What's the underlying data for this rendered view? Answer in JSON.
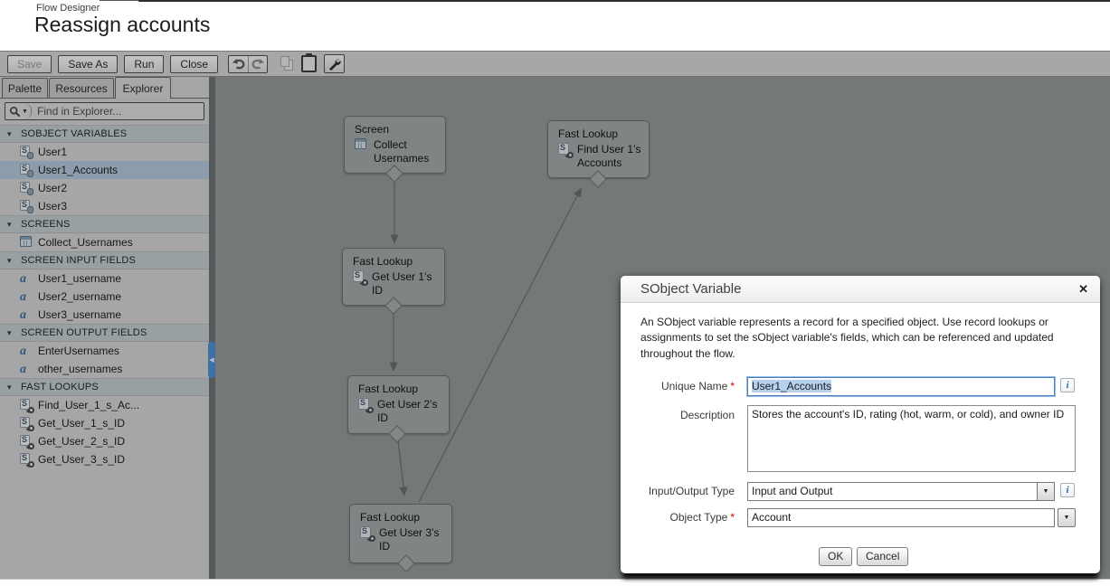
{
  "window": {
    "app_label": "Flow Designer",
    "title": "Reassign accounts"
  },
  "toolbar": {
    "save_label": "Save",
    "save_as_label": "Save As",
    "run_label": "Run",
    "close_label": "Close",
    "icons": [
      "undo-icon",
      "redo-icon",
      "copy-icon",
      "paste-icon",
      "wrench-icon"
    ]
  },
  "sidebar": {
    "tabs": [
      {
        "label": "Palette"
      },
      {
        "label": "Resources"
      },
      {
        "label": "Explorer"
      }
    ],
    "active_tab": "Explorer",
    "search_placeholder": "Find in Explorer...",
    "rows": [
      {
        "kind": "header",
        "label": "SOBJECT VARIABLES"
      },
      {
        "kind": "item",
        "icon": "sobject-variable-icon",
        "label": "User1"
      },
      {
        "kind": "item",
        "icon": "sobject-variable-icon",
        "label": "User1_Accounts",
        "selected": true
      },
      {
        "kind": "item",
        "icon": "sobject-variable-icon",
        "label": "User2"
      },
      {
        "kind": "item",
        "icon": "sobject-variable-icon",
        "label": "User3"
      },
      {
        "kind": "header",
        "label": "SCREENS"
      },
      {
        "kind": "item",
        "icon": "screen-icon",
        "label": "Collect_Usernames"
      },
      {
        "kind": "header",
        "label": "SCREEN INPUT FIELDS"
      },
      {
        "kind": "item",
        "icon": "text-field-icon",
        "label": "User1_username"
      },
      {
        "kind": "item",
        "icon": "text-field-icon",
        "label": "User2_username"
      },
      {
        "kind": "item",
        "icon": "text-field-icon",
        "label": "User3_username"
      },
      {
        "kind": "header",
        "label": "SCREEN OUTPUT FIELDS"
      },
      {
        "kind": "item",
        "icon": "text-field-icon",
        "label": "EnterUsernames"
      },
      {
        "kind": "item",
        "icon": "text-field-icon",
        "label": "other_usernames"
      },
      {
        "kind": "header",
        "label": "FAST LOOKUPS"
      },
      {
        "kind": "item",
        "icon": "fast-lookup-icon",
        "label": "Find_User_1_s_Ac..."
      },
      {
        "kind": "item",
        "icon": "fast-lookup-icon",
        "label": "Get_User_1_s_ID"
      },
      {
        "kind": "item",
        "icon": "fast-lookup-icon",
        "label": "Get_User_2_s_ID"
      },
      {
        "kind": "item",
        "icon": "fast-lookup-icon",
        "label": "Get_User_3_s_ID"
      }
    ]
  },
  "canvas": {
    "nodes": [
      {
        "type_label": "Screen",
        "name": "Collect Usernames",
        "icon": "screen-icon"
      },
      {
        "type_label": "Fast Lookup",
        "name": "Find User 1’s Accounts",
        "icon": "fast-lookup-icon"
      },
      {
        "type_label": "Fast Lookup",
        "name": "Get User 1’s ID",
        "icon": "fast-lookup-icon"
      },
      {
        "type_label": "Fast Lookup",
        "name": "Get User 2’s ID",
        "icon": "fast-lookup-icon"
      },
      {
        "type_label": "Fast Lookup",
        "name": "Get User 3’s ID",
        "icon": "fast-lookup-icon"
      }
    ]
  },
  "modal": {
    "title": "SObject Variable",
    "close_glyph": "✕",
    "intro": "An SObject variable represents a record for a specified object. Use record lookups or assignments to set the sObject variable's fields, which can be referenced and updated throughout the flow.",
    "required_marker": "*",
    "fields": {
      "unique_name": {
        "label": "Unique Name",
        "value": "User1_Accounts"
      },
      "description": {
        "label": "Description",
        "value": "Stores the account's ID, rating (hot, warm, or cold), and owner ID"
      },
      "io_type": {
        "label": "Input/Output Type",
        "value": "Input and Output"
      },
      "object_type": {
        "label": "Object Type",
        "value": "Account"
      }
    },
    "info_icon_glyph": "i",
    "buttons": {
      "ok": "OK",
      "cancel": "Cancel"
    }
  },
  "colors": {
    "selection_blue": "#b6d1ee",
    "required_red": "#cc0000",
    "canvas_grey": "#95999a",
    "splitter_handle_blue": "#4e8ed0"
  }
}
